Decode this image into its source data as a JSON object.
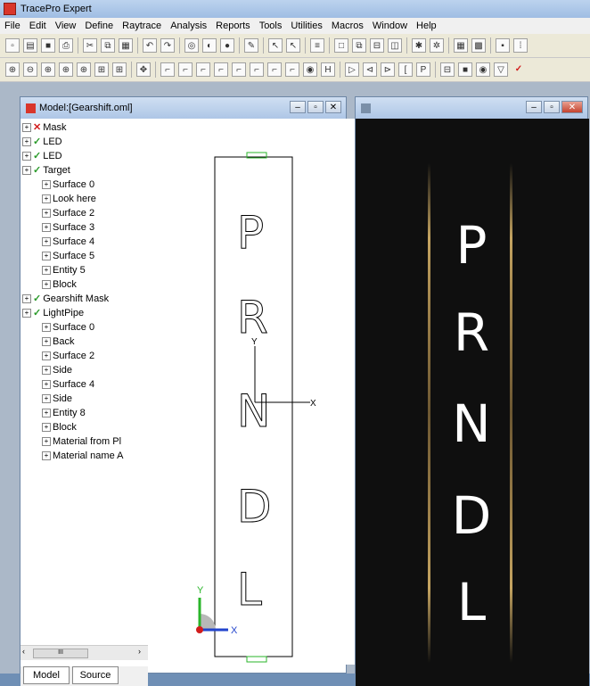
{
  "app": {
    "title": "TracePro Expert"
  },
  "menu": [
    "File",
    "Edit",
    "View",
    "Define",
    "Raytrace",
    "Analysis",
    "Reports",
    "Tools",
    "Utilities",
    "Macros",
    "Window",
    "Help"
  ],
  "model_window": {
    "title": "Model:[Gearshift.oml]",
    "tree": [
      {
        "label": "Mask",
        "status": "x",
        "level": 0
      },
      {
        "label": "LED",
        "status": "check",
        "level": 0
      },
      {
        "label": "LED",
        "status": "check",
        "level": 0
      },
      {
        "label": "Target",
        "status": "check",
        "level": 0
      },
      {
        "label": "Surface 0",
        "status": "",
        "level": 1
      },
      {
        "label": "Look here",
        "status": "",
        "level": 1
      },
      {
        "label": "Surface 2",
        "status": "",
        "level": 1
      },
      {
        "label": "Surface 3",
        "status": "",
        "level": 1
      },
      {
        "label": "Surface 4",
        "status": "",
        "level": 1
      },
      {
        "label": "Surface 5",
        "status": "",
        "level": 1
      },
      {
        "label": "Entity 5",
        "status": "",
        "level": 1
      },
      {
        "label": "Block",
        "status": "",
        "level": 1
      },
      {
        "label": "Gearshift Mask",
        "status": "check",
        "level": 0
      },
      {
        "label": "LightPipe",
        "status": "check",
        "level": 0
      },
      {
        "label": "Surface 0",
        "status": "",
        "level": 1
      },
      {
        "label": "Back",
        "status": "",
        "level": 1
      },
      {
        "label": "Surface 2",
        "status": "",
        "level": 1
      },
      {
        "label": "Side",
        "status": "",
        "level": 1
      },
      {
        "label": "Surface 4",
        "status": "",
        "level": 1
      },
      {
        "label": "Side",
        "status": "",
        "level": 1
      },
      {
        "label": "Entity 8",
        "status": "",
        "level": 1
      },
      {
        "label": "Block",
        "status": "",
        "level": 1
      },
      {
        "label": "Material from Pl",
        "status": "",
        "level": 1
      },
      {
        "label": "Material name A",
        "status": "",
        "level": 1
      }
    ],
    "tabs": [
      "Model",
      "Source"
    ],
    "letters": [
      "P",
      "R",
      "N",
      "D",
      "L"
    ],
    "axis_labels": {
      "x": "X",
      "y": "Y"
    },
    "triad_labels": {
      "x": "X",
      "y": "Y"
    }
  },
  "render_window": {
    "letters": [
      "P",
      "R",
      "N",
      "D",
      "L"
    ],
    "colors": {
      "background": "#0f0f0f",
      "glow": "#d9b56a",
      "text": "#ffffff"
    }
  }
}
